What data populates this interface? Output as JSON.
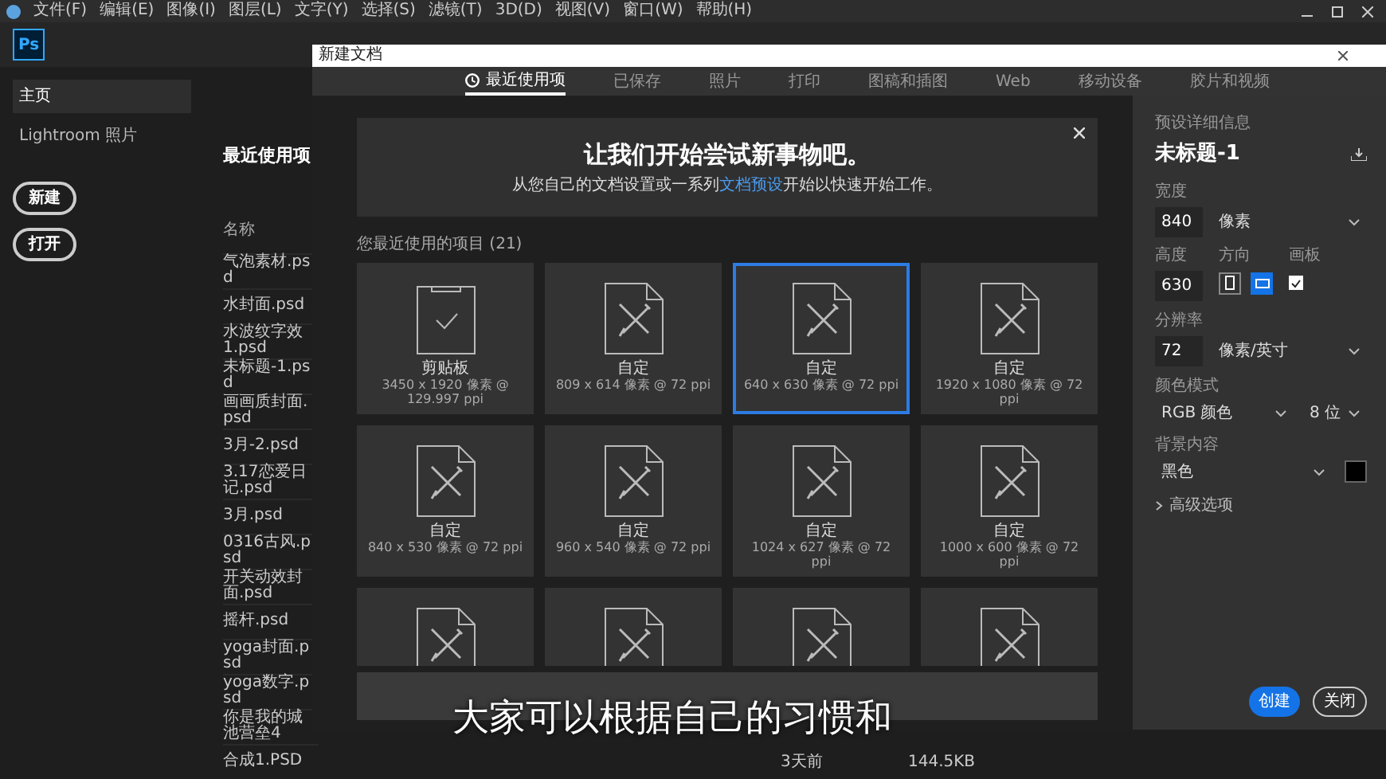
{
  "menu": [
    {
      "label": "文件(F)"
    },
    {
      "label": "编辑(E)"
    },
    {
      "label": "图像(I)"
    },
    {
      "label": "图层(L)"
    },
    {
      "label": "文字(Y)"
    },
    {
      "label": "选择(S)"
    },
    {
      "label": "滤镜(T)"
    },
    {
      "label": "3D(D)"
    },
    {
      "label": "视图(V)"
    },
    {
      "label": "窗口(W)"
    },
    {
      "label": "帮助(H)"
    }
  ],
  "app_logo": "Ps",
  "sidebar": {
    "items": [
      {
        "label": "主页",
        "selected": true
      },
      {
        "label": "Lightroom 照片",
        "selected": false
      }
    ],
    "buttons": [
      "新建",
      "打开"
    ]
  },
  "recent": {
    "title": "最近使用项",
    "column": "名称",
    "files": [
      {
        "name": "气泡素材.psd"
      },
      {
        "name": "水封面.psd"
      },
      {
        "name": "水波纹字效1.psd"
      },
      {
        "name": "未标题-1.psd"
      },
      {
        "name": "画画质封面.psd"
      },
      {
        "name": "3月-2.psd"
      },
      {
        "name": "3.17恋爱日记.psd"
      },
      {
        "name": "3月.psd"
      },
      {
        "name": "0316古风.psd"
      },
      {
        "name": "开关动效封面.psd"
      },
      {
        "name": "摇杆.psd"
      },
      {
        "name": "yoga封面.psd"
      },
      {
        "name": "yoga数字.psd"
      },
      {
        "name": "你是我的城池营垒4"
      },
      {
        "name": "合成1.PSD",
        "modified": "3天前",
        "size": "144.5KB"
      }
    ]
  },
  "dialog": {
    "title": "新建文档",
    "tabs": [
      {
        "label": "最近使用项",
        "selected": true
      },
      {
        "label": "已保存",
        "selected": false
      },
      {
        "label": "照片",
        "selected": false
      },
      {
        "label": "打印",
        "selected": false
      },
      {
        "label": "图稿和插图",
        "selected": false
      },
      {
        "label": "Web",
        "selected": false
      },
      {
        "label": "移动设备",
        "selected": false
      },
      {
        "label": "胶片和视频",
        "selected": false
      }
    ],
    "banner": {
      "title": "让我们开始尝试新事物吧。",
      "text_before": "从您自己的文档设置或一系列",
      "link": "文档预设",
      "text_after": "开始以快速开始工作。"
    },
    "section_label": "您最近使用的项目 (21)",
    "cards": [
      {
        "kind": "clipboard",
        "name": "剪贴板",
        "spec": "3450 x 1920 像素 @ 129.997 ppi",
        "selected": false
      },
      {
        "kind": "document",
        "name": "自定",
        "spec": "809 x 614 像素 @ 72 ppi",
        "selected": false
      },
      {
        "kind": "document",
        "name": "自定",
        "spec": "640 x 630 像素 @ 72 ppi",
        "selected": true
      },
      {
        "kind": "document",
        "name": "自定",
        "spec": "1920 x 1080 像素 @ 72 ppi",
        "selected": false
      },
      {
        "kind": "document",
        "name": "自定",
        "spec": "840 x 530 像素 @ 72 ppi",
        "selected": false
      },
      {
        "kind": "document",
        "name": "自定",
        "spec": "960 x 540 像素 @ 72 ppi",
        "selected": false
      },
      {
        "kind": "document",
        "name": "自定",
        "spec": "1024 x 627 像素 @ 72 ppi",
        "selected": false
      },
      {
        "kind": "document",
        "name": "自定",
        "spec": "1000 x 600 像素 @ 72 ppi",
        "selected": false
      },
      {
        "kind": "document",
        "selected": false
      },
      {
        "kind": "document",
        "selected": false
      },
      {
        "kind": "document",
        "selected": false
      },
      {
        "kind": "document",
        "selected": false
      }
    ],
    "preset": {
      "header": "预设详细信息",
      "name": "未标题-1",
      "width": {
        "label": "宽度",
        "value": "840",
        "unit": "像素"
      },
      "height": {
        "label": "高度",
        "value": "630"
      },
      "orientation": {
        "label": "方向",
        "options": [
          {
            "kind": "portrait",
            "selected": false
          },
          {
            "kind": "landscape",
            "selected": true
          }
        ]
      },
      "artboard": {
        "label": "画板",
        "checked": true
      },
      "resolution": {
        "label": "分辨率",
        "value": "72",
        "unit": "像素/英寸"
      },
      "color_mode": {
        "label": "颜色模式",
        "mode": "RGB 颜色",
        "depth": "8 位"
      },
      "background": {
        "label": "背景内容",
        "value": "黑色",
        "color": "#000000"
      },
      "advanced": "高级选项"
    },
    "buttons": [
      {
        "label": "创建",
        "primary": true
      },
      {
        "label": "关闭",
        "primary": false
      }
    ]
  },
  "subtitle": "大家可以根据自己的习惯和"
}
